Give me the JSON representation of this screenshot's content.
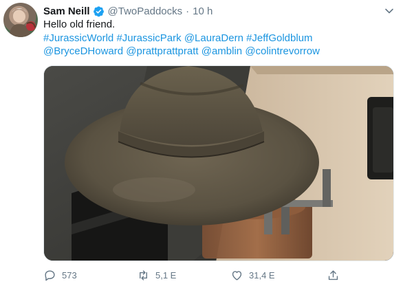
{
  "author": {
    "display_name": "Sam Neill",
    "handle": "@TwoPaddocks",
    "time": "10 h"
  },
  "tweet": {
    "text_line": "Hello old friend.",
    "tags": [
      "#JurassicWorld",
      "#JurassicPark",
      "@LauraDern",
      "#JeffGoldblum",
      "@BryceDHoward",
      "@prattprattpratt",
      "@amblin",
      "@colintrevorrow"
    ]
  },
  "actions": {
    "replies": "573",
    "retweets": "5,1 E",
    "likes": "31,4 E"
  },
  "colors": {
    "link": "#1b95e0",
    "secondary_text": "#657786",
    "verified": "#1da1f2"
  },
  "icons": [
    "verified-badge-icon",
    "caret-down-icon",
    "reply-icon",
    "retweet-icon",
    "like-icon",
    "share-icon"
  ]
}
